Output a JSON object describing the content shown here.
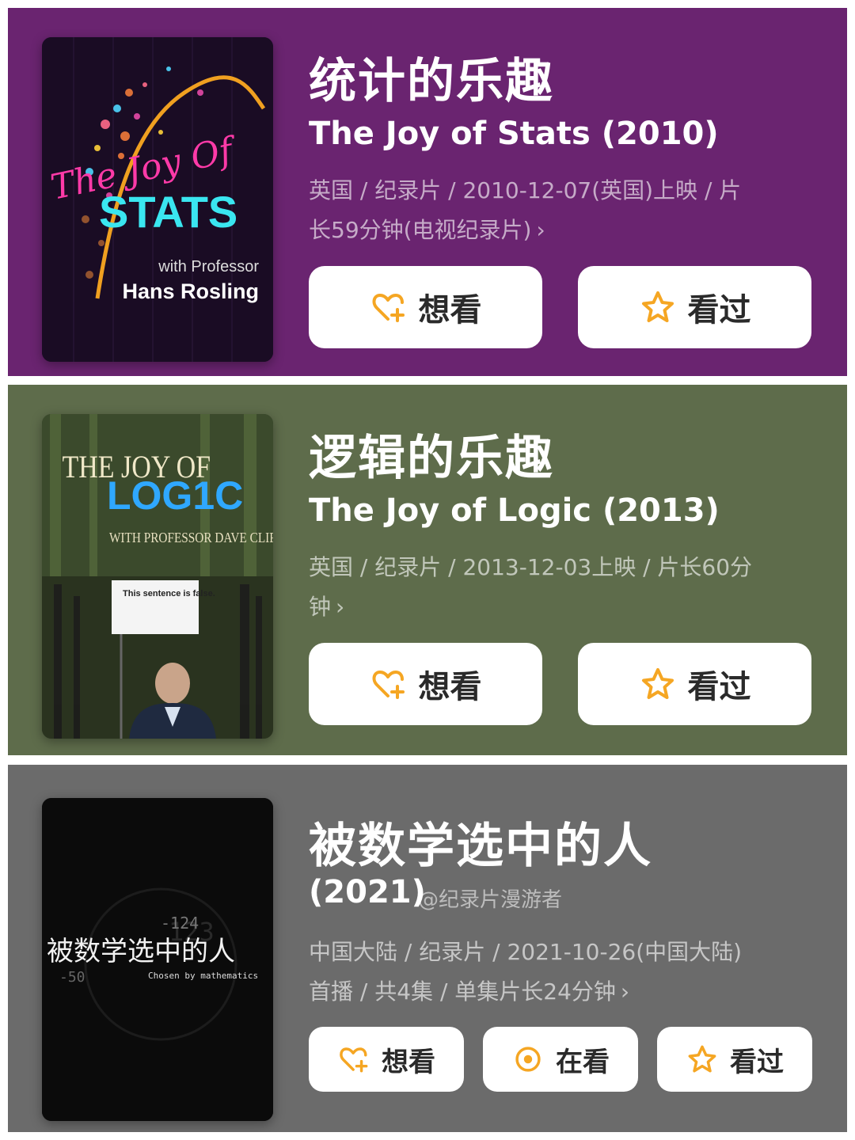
{
  "colors": {
    "accent": "#f5a623",
    "card1_bg": "#6a2470",
    "card2_bg": "#5e6c4b",
    "card3_bg": "#6b6b6b"
  },
  "items": [
    {
      "title_zh": "统计的乐趣",
      "title_en": "The Joy of Stats (2010)",
      "meta_line1": "英国 / 纪录片 / 2010-12-07(英国)上映 / 片",
      "meta_line2": "长59分钟(电视纪录片)",
      "meta_chevron": "›",
      "poster": {
        "line1": "The Joy Of",
        "line2": "STATS",
        "line3": "with Professor",
        "line4": "Hans Rosling"
      },
      "buttons": [
        {
          "label": "想看",
          "icon": "heart-plus-icon"
        },
        {
          "label": "看过",
          "icon": "star-icon"
        }
      ]
    },
    {
      "title_zh": "逻辑的乐趣",
      "title_en": "The Joy of Logic (2013)",
      "meta_line1": "英国 / 纪录片 / 2013-12-03上映 / 片长60分",
      "meta_line2": "钟",
      "meta_chevron": "›",
      "poster": {
        "line1": "THE JOY OF",
        "line2": "LOG1C",
        "line3": "WITH PROFESSOR DAVE CLIFF",
        "sign": "This sentence is false."
      },
      "buttons": [
        {
          "label": "想看",
          "icon": "heart-plus-icon"
        },
        {
          "label": "看过",
          "icon": "star-icon"
        }
      ]
    },
    {
      "title_zh": "被数学选中的人",
      "title_en": "(2021)",
      "watermark": "@纪录片漫游者",
      "meta_line1": "中国大陆 / 纪录片 / 2021-10-26(中国大陆)",
      "meta_line2": "首播 / 共4集 / 单集片长24分钟",
      "meta_chevron": "›",
      "poster": {
        "title": "被数学选中的人",
        "subtitle": "Chosen by mathematics",
        "num1": "123",
        "num2": "-124",
        "num3": "-50"
      },
      "buttons": [
        {
          "label": "想看",
          "icon": "heart-plus-icon"
        },
        {
          "label": "在看",
          "icon": "circle-dot-icon"
        },
        {
          "label": "看过",
          "icon": "star-icon"
        }
      ]
    }
  ]
}
